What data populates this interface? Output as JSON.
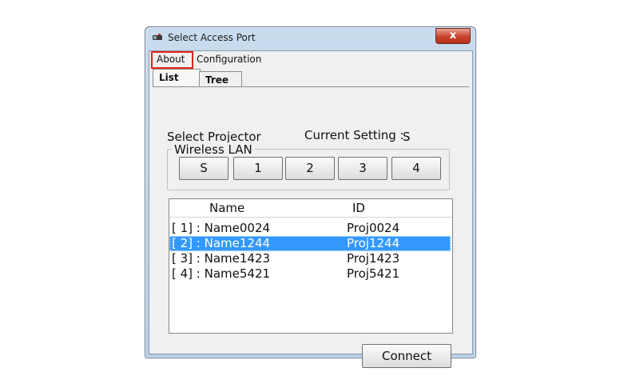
{
  "window": {
    "title": "Select Access Port",
    "close_label": "x"
  },
  "menubar": {
    "items": [
      "About",
      "Configuration"
    ]
  },
  "tabs": [
    "List",
    "Tree"
  ],
  "main": {
    "select_projector_label": "Select Projector",
    "current_setting_label": "Current Setting :",
    "current_setting_value": "S",
    "group_title": "Wireless LAN",
    "port_buttons": [
      "S",
      "1",
      "2",
      "3",
      "4"
    ]
  },
  "list": {
    "columns": [
      "Name",
      "ID"
    ],
    "rows": [
      {
        "name": "[ 1] : Name0024",
        "id": "Proj0024",
        "selected": false
      },
      {
        "name": "[ 2] : Name1244",
        "id": "Proj1244",
        "selected": true
      },
      {
        "name": "[ 3] : Name1423",
        "id": "Proj1423",
        "selected": false
      },
      {
        "name": "[ 4] : Name5421",
        "id": "Proj5421",
        "selected": false
      }
    ]
  },
  "footer": {
    "connect_label": "Connect"
  },
  "colors": {
    "selection": "#3399ff",
    "highlight_box": "#e0241b"
  }
}
